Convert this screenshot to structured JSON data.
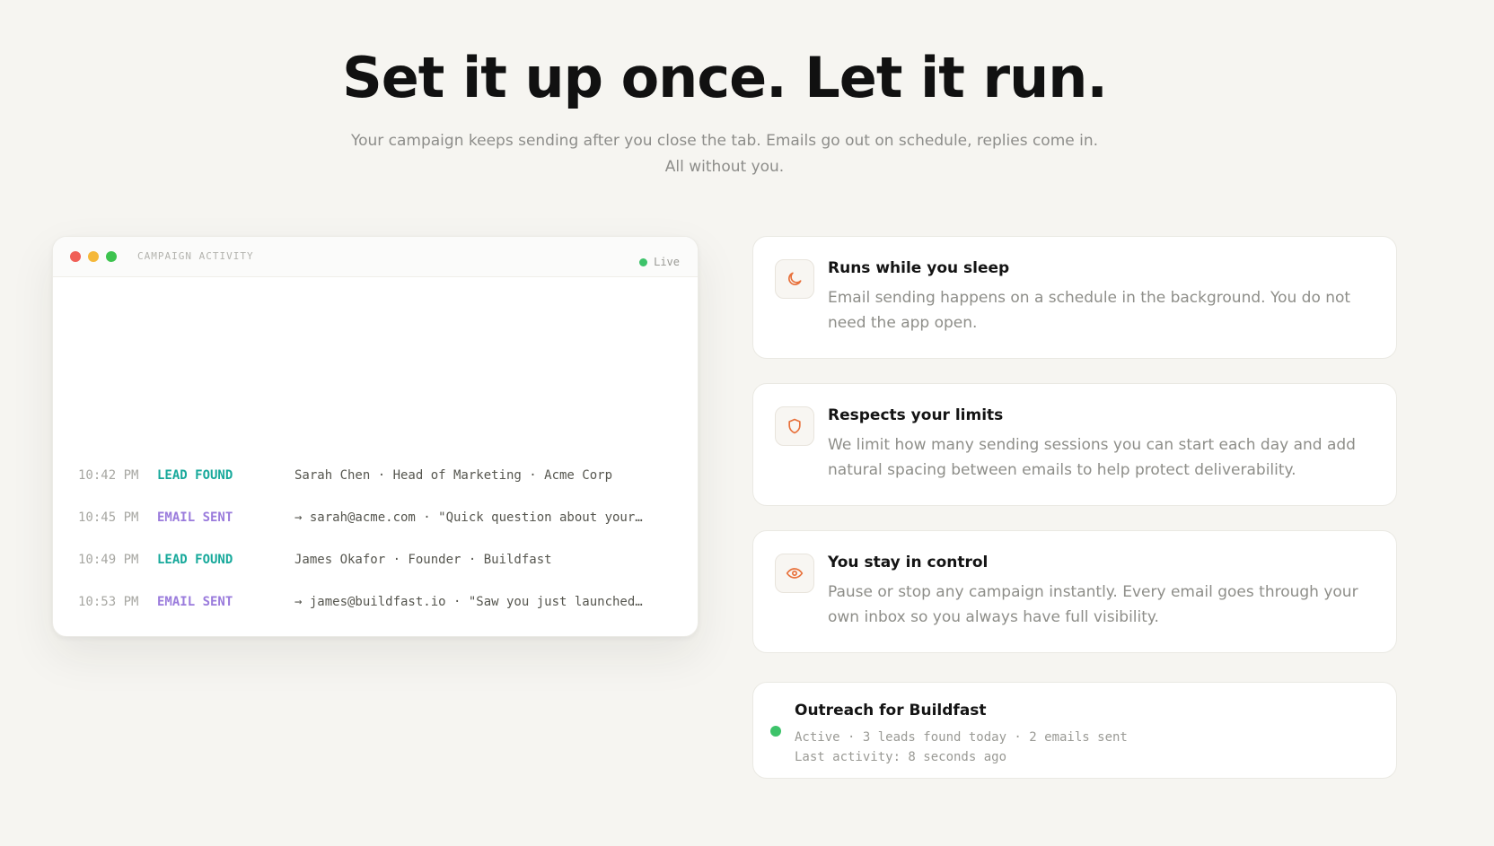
{
  "hero": {
    "title": "Set it up once. Let it run.",
    "subtitle_line1": "Your campaign keeps sending after you close the tab. Emails go out on schedule, replies come in.",
    "subtitle_line2": "All without you."
  },
  "activity_window": {
    "title": "CAMPAIGN ACTIVITY",
    "live_label": "Live",
    "colors": {
      "lead_found": "#17a99b",
      "email_sent": "#9a7bdc",
      "live_dot": "#3dc36a"
    },
    "rows": [
      {
        "time": "10:42 PM",
        "type": "LEAD FOUND",
        "kind": "lead",
        "detail": "Sarah Chen · Head of Marketing · Acme Corp"
      },
      {
        "time": "10:45 PM",
        "type": "EMAIL SENT",
        "kind": "email",
        "detail": "→ sarah@acme.com · \"Quick question about your…"
      },
      {
        "time": "10:49 PM",
        "type": "LEAD FOUND",
        "kind": "lead",
        "detail": "James Okafor · Founder · Buildfast"
      },
      {
        "time": "10:53 PM",
        "type": "EMAIL SENT",
        "kind": "email",
        "detail": "→ james@buildfast.io · \"Saw you just launched…"
      }
    ]
  },
  "features": [
    {
      "icon": "moon-icon",
      "title": "Runs while you sleep",
      "description": "Email sending happens on a schedule in the background. You do not need the app open."
    },
    {
      "icon": "shield-icon",
      "title": "Respects your limits",
      "description": "We limit how many sending sessions you can start each day and add natural spacing between emails to help protect deliverability."
    },
    {
      "icon": "eye-icon",
      "title": "You stay in control",
      "description": "Pause or stop any campaign instantly. Every email goes through your own inbox so you always have full visibility."
    }
  ],
  "campaign_status": {
    "name": "Outreach for Buildfast",
    "summary": "Active · 3 leads found today · 2 emails sent",
    "last_activity": "Last activity: 8 seconds ago",
    "status_color": "#3dc36a"
  },
  "accent_color": "#e8703a"
}
